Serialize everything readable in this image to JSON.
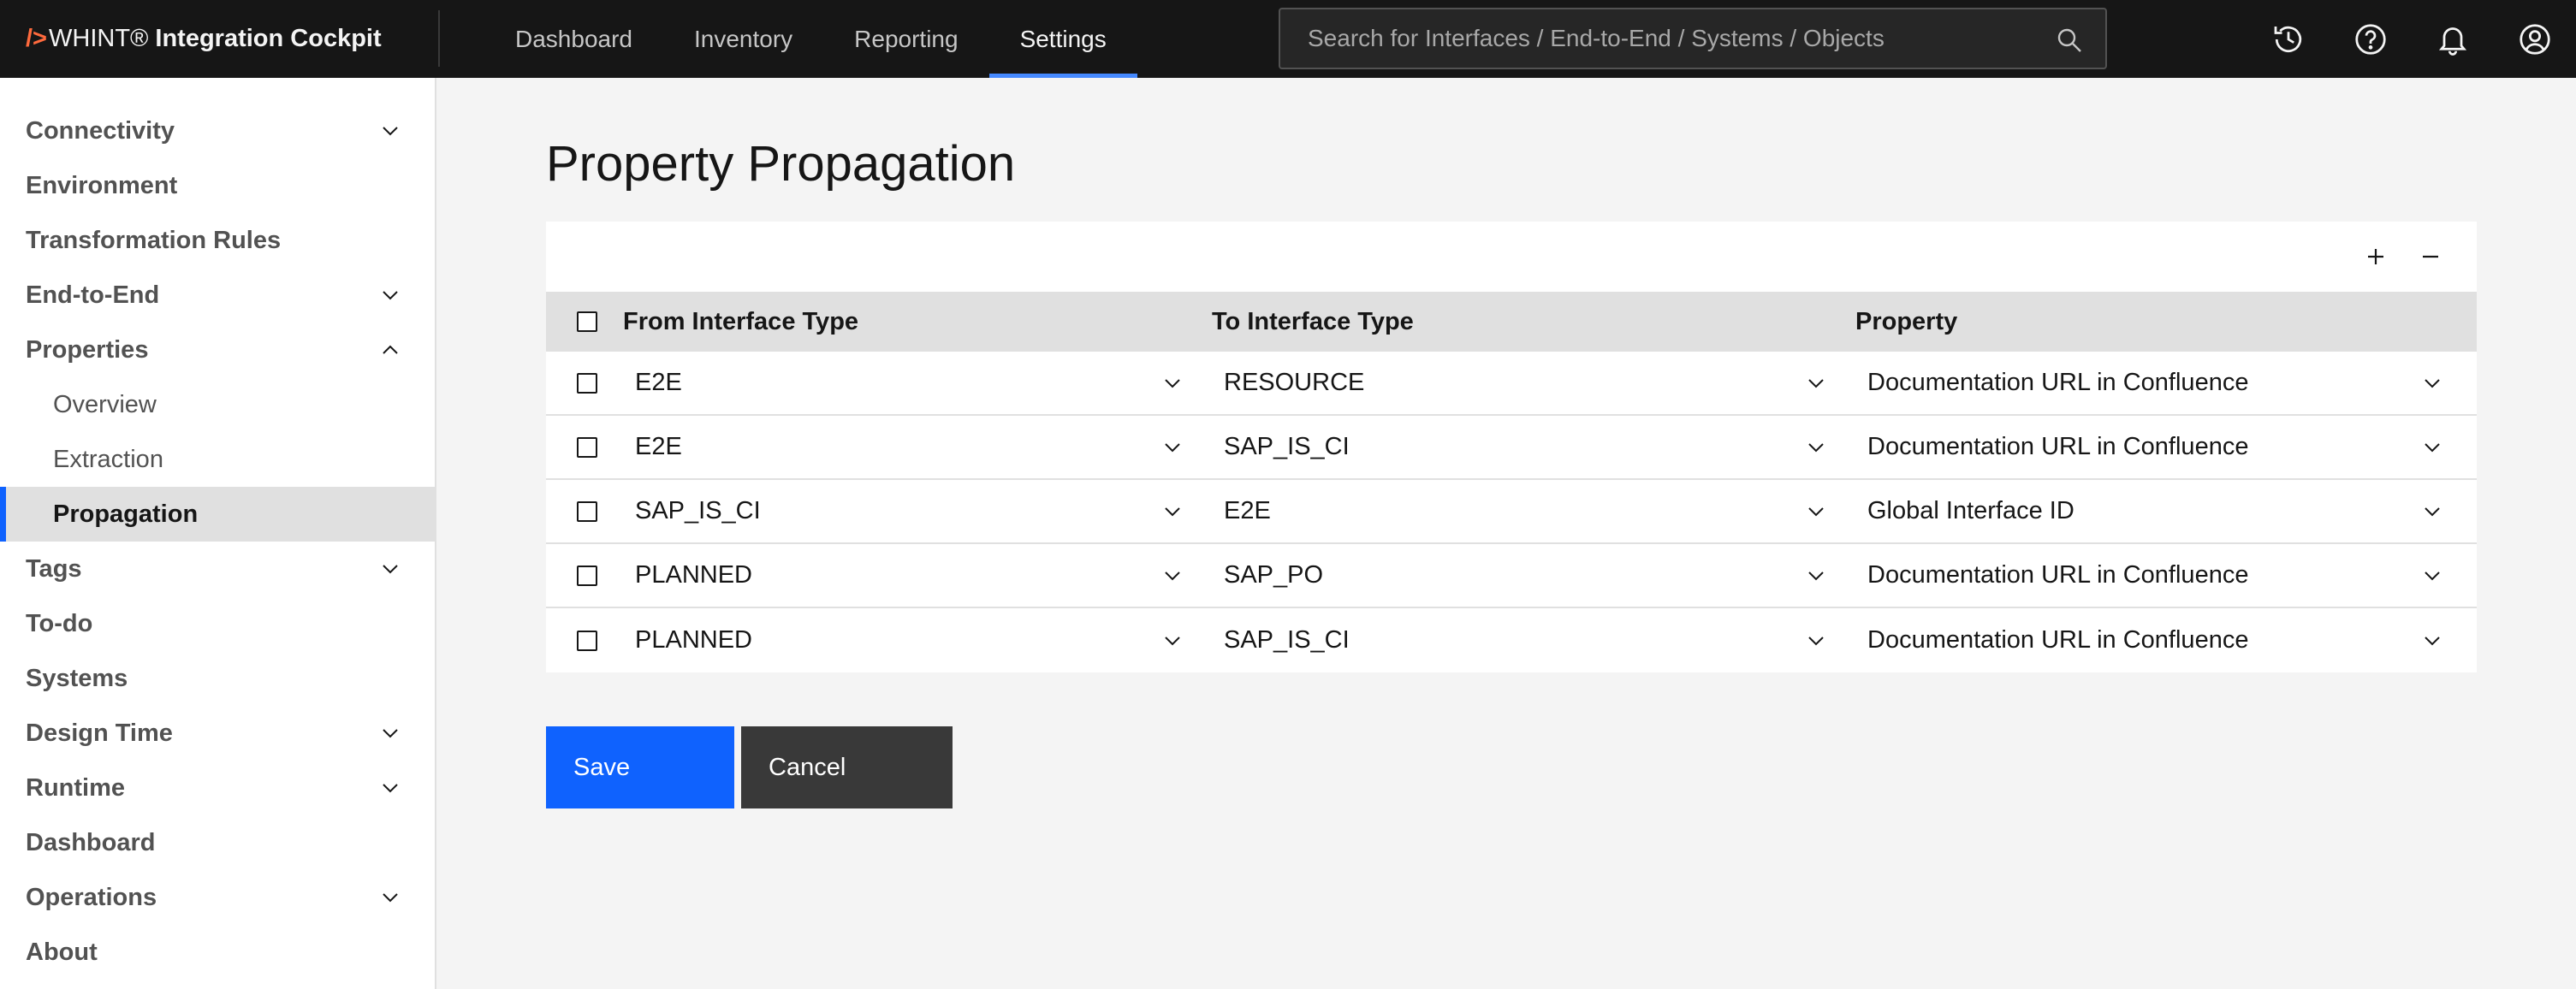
{
  "app": {
    "brand_prefix": "/>",
    "brand_name": "WHINT®",
    "brand_product": "Integration Cockpit"
  },
  "nav": {
    "items": [
      {
        "label": "Dashboard"
      },
      {
        "label": "Inventory"
      },
      {
        "label": "Reporting"
      },
      {
        "label": "Settings",
        "active": true
      }
    ]
  },
  "search": {
    "placeholder": "Search for Interfaces / End-to-End / Systems / Objects",
    "value": ""
  },
  "header_icons": [
    "history-icon",
    "help-icon",
    "notification-icon",
    "user-avatar-icon"
  ],
  "sidebar": {
    "items": [
      {
        "label": "Connectivity",
        "expandable": true,
        "expanded": false
      },
      {
        "label": "Environment"
      },
      {
        "label": "Transformation Rules"
      },
      {
        "label": "End-to-End",
        "expandable": true,
        "expanded": false
      },
      {
        "label": "Properties",
        "expandable": true,
        "expanded": true
      },
      {
        "label": "Overview",
        "sub": true
      },
      {
        "label": "Extraction",
        "sub": true
      },
      {
        "label": "Propagation",
        "sub": true,
        "active": true
      },
      {
        "label": "Tags",
        "expandable": true,
        "expanded": false
      },
      {
        "label": "To-do"
      },
      {
        "label": "Systems"
      },
      {
        "label": "Design Time",
        "expandable": true,
        "expanded": false
      },
      {
        "label": "Runtime",
        "expandable": true,
        "expanded": false
      },
      {
        "label": "Dashboard"
      },
      {
        "label": "Operations",
        "expandable": true,
        "expanded": false
      },
      {
        "label": "About"
      }
    ]
  },
  "main": {
    "title": "Property Propagation",
    "table": {
      "headers": {
        "from": "From Interface Type",
        "to": "To Interface Type",
        "property": "Property"
      },
      "rows": [
        {
          "from": "E2E",
          "to": "RESOURCE",
          "property": "Documentation URL in Confluence"
        },
        {
          "from": "E2E",
          "to": "SAP_IS_CI",
          "property": "Documentation URL in Confluence"
        },
        {
          "from": "SAP_IS_CI",
          "to": "E2E",
          "property": "Global Interface ID"
        },
        {
          "from": "PLANNED",
          "to": "SAP_PO",
          "property": "Documentation URL in Confluence"
        },
        {
          "from": "PLANNED",
          "to": "SAP_IS_CI",
          "property": "Documentation URL in Confluence"
        }
      ]
    },
    "toolbar": {
      "add_label": "+",
      "remove_label": "−"
    },
    "buttons": {
      "save": "Save",
      "cancel": "Cancel"
    }
  },
  "colors": {
    "header_bg": "#161616",
    "accent": "#0f62fe",
    "nav_active_underline": "#4589ff",
    "brand_mark": "#ff6a3d",
    "page_bg": "#f4f4f4",
    "cancel_bg": "#393939"
  }
}
